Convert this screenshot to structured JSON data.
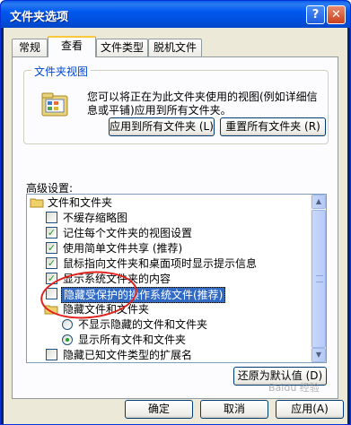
{
  "window": {
    "title": "文件夹选项",
    "help_glyph": "?",
    "close_glyph": "✕"
  },
  "tabs": [
    {
      "label": "常规"
    },
    {
      "label": "查看"
    },
    {
      "label": "文件类型"
    },
    {
      "label": "脱机文件"
    }
  ],
  "active_tab": "查看",
  "folder_view": {
    "legend": "文件夹视图",
    "description": "您可以将正在为此文件夹使用的视图(例如详细信息或平铺)应用到所有文件夹。",
    "apply_all_button": "应用到所有文件夹 (L)",
    "reset_all_button": "重置所有文件夹 (R)",
    "icon": "folder-view-icon"
  },
  "advanced": {
    "label": "高级设置:",
    "items": [
      {
        "type": "folder",
        "label": "文件和文件夹",
        "indent": 0
      },
      {
        "type": "checkbox",
        "label": "不缓存缩略图",
        "checked": false,
        "indent": 1
      },
      {
        "type": "checkbox",
        "label": "记住每个文件夹的视图设置",
        "checked": true,
        "indent": 1
      },
      {
        "type": "checkbox",
        "label": "使用简单文件共享 (推荐)",
        "checked": true,
        "indent": 1
      },
      {
        "type": "checkbox",
        "label": "鼠标指向文件夹和桌面项时显示提示信息",
        "checked": true,
        "indent": 1
      },
      {
        "type": "checkbox",
        "label": "显示系统文件夹的内容",
        "checked": true,
        "indent": 1
      },
      {
        "type": "checkbox",
        "label": "隐藏受保护的操作系统文件(推荐)",
        "checked": false,
        "indent": 1,
        "selected": true
      },
      {
        "type": "folder",
        "label": "隐藏文件和文件夹",
        "indent": 1
      },
      {
        "type": "radio",
        "label": "不显示隐藏的文件和文件夹",
        "checked": false,
        "indent": 2
      },
      {
        "type": "radio",
        "label": "显示所有文件和文件夹",
        "checked": true,
        "indent": 2
      },
      {
        "type": "checkbox",
        "label": "隐藏已知文件类型的扩展名",
        "checked": false,
        "indent": 1
      }
    ]
  },
  "restore_defaults_button": "还原为默认值 (D)",
  "footer": {
    "ok": "确定",
    "cancel": "取消",
    "apply": "应用(A)"
  },
  "watermark": "Baidu 经验",
  "colors": {
    "title_blue": "#0054e3",
    "client_bg": "#ece9d8",
    "highlight": "#316ac5",
    "annotation_red": "#e0201a",
    "check_green": "#21a121"
  }
}
